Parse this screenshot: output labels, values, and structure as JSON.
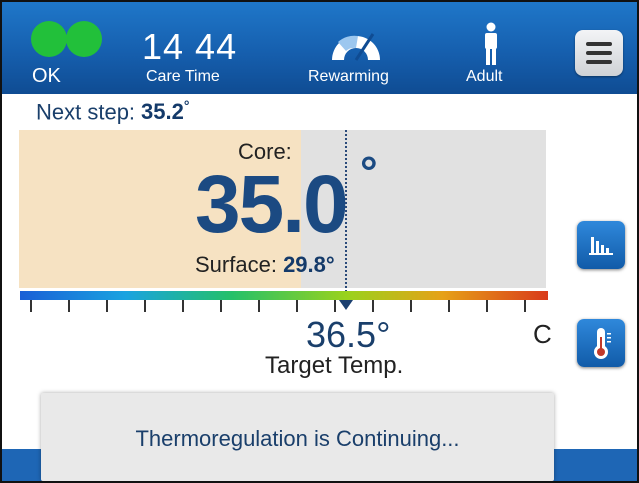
{
  "header": {
    "status": "OK",
    "status_color": "#22c03a",
    "time": "14 44",
    "time_label": "Care Time",
    "mode_label": "Rewarming",
    "patient_label": "Adult"
  },
  "next_step": {
    "label": "Next step:",
    "value": "35.2",
    "unit": "°"
  },
  "core": {
    "label": "Core:",
    "value": "35.0",
    "unit": "°"
  },
  "surface": {
    "label": "Surface:",
    "value": "29.8",
    "unit": "°"
  },
  "target": {
    "value": "36.5",
    "unit": "°",
    "label": "Target Temp.",
    "scale_unit": "C"
  },
  "toast": {
    "message": "Thermoregulation is Continuing..."
  },
  "icons": {
    "status": "status-lights-icon",
    "mode": "rewarming-gauge-icon",
    "patient": "adult-person-icon",
    "menu": "menu-icon",
    "chart": "bar-chart-icon",
    "thermometer": "thermometer-icon"
  }
}
